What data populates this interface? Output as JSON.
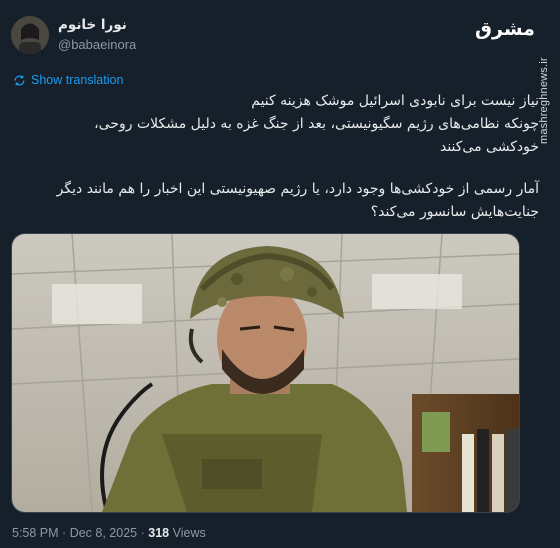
{
  "author": {
    "display_name": "نورا خانوم",
    "handle": "@babaeinora"
  },
  "more_menu": "···",
  "brand": {
    "logo_text": "مشرق",
    "watermark": "mashreghnews.ir"
  },
  "translate": {
    "label": "Show translation"
  },
  "tweet": {
    "lines": [
      "نیاز نیست برای نابودی اسرائیل موشک هزینه کنیم",
      "چونکه نظامی‌های رژیم سگیونیستی، بعد از جنگ غزه به دلیل مشکلات روحی،",
      "خودکشی می‌کنند",
      "آمار رسمی از خودکشی‌ها وجود دارد، یا رژیم صهیونیستی این اخبار را هم مانند دیگر",
      "جنایت‌هایش سانسور می‌کند؟"
    ]
  },
  "media": {
    "icon": "soldier-photo"
  },
  "footer": {
    "time": "5:58 PM",
    "separator": "·",
    "date": "Dec 8, 2025",
    "views_count": "318",
    "views_label": "Views"
  },
  "colors": {
    "background": "#15202b",
    "text": "#e7e9ea",
    "secondary": "#8b98a5",
    "link": "#1d9bf0"
  }
}
